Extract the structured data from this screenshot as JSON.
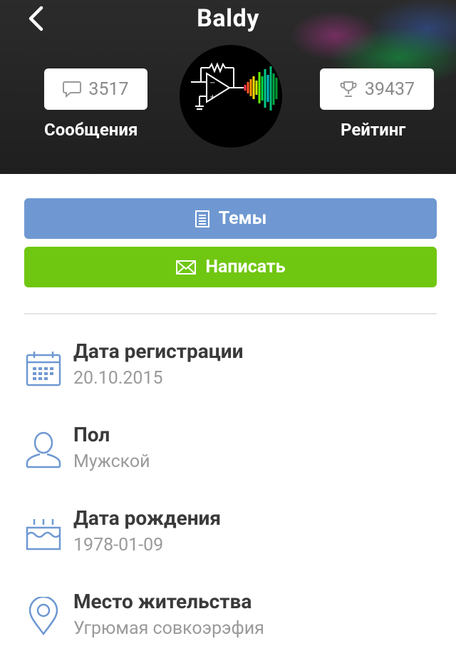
{
  "header": {
    "title": "Baldy",
    "messages_count": "3517",
    "messages_label": "Сообщения",
    "rating_count": "39437",
    "rating_label": "Рейтинг"
  },
  "actions": {
    "topics_label": "Темы",
    "write_label": "Написать"
  },
  "profile": [
    {
      "icon": "calendar-icon",
      "label": "Дата регистрации",
      "value": "20.10.2015"
    },
    {
      "icon": "person-icon",
      "label": "Пол",
      "value": "Мужской"
    },
    {
      "icon": "birthday-cake-icon",
      "label": "Дата рождения",
      "value": "1978-01-09"
    },
    {
      "icon": "location-pin-icon",
      "label": "Место жительства",
      "value": "Угрюмая совкоэрэфия"
    }
  ],
  "colors": {
    "topics_button": "#6f98d2",
    "write_button": "#70c711",
    "icon_blue": "#6f98d2"
  }
}
